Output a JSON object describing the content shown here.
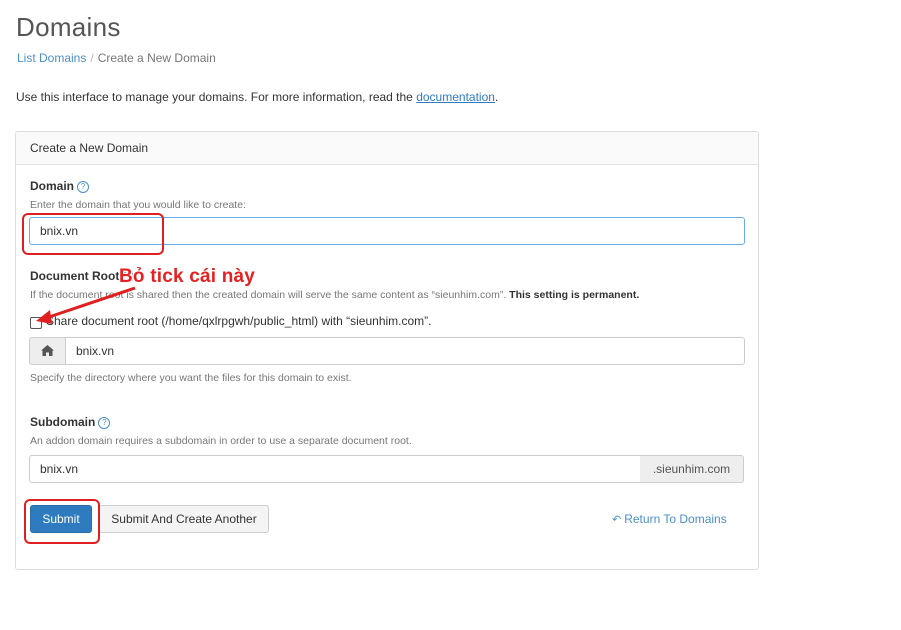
{
  "page": {
    "title": "Domains",
    "breadcrumb": {
      "link": "List Domains",
      "separator": "/",
      "current": "Create a New Domain"
    },
    "intro_text": "Use this interface to manage your domains. For more information, read the ",
    "intro_link": "documentation",
    "intro_end": "."
  },
  "panel": {
    "heading": "Create a New Domain",
    "domain": {
      "label": "Domain",
      "help": "?",
      "hint": "Enter the domain that you would like to create:",
      "value": "bnix.vn"
    },
    "docroot": {
      "label": "Document Root",
      "help": "?",
      "hint_normal": "If the document root is shared then the created domain will serve the same content as “sieunhim.com”. ",
      "hint_bold": "This setting is permanent.",
      "share_label": "Share document root (/home/qxlrpgwh/public_html) with “sieunhim.com”.",
      "share_checked": false,
      "home_icon": "home-icon",
      "value": "bnix.vn",
      "help_text": "Specify the directory where you want the files for this domain to exist."
    },
    "subdomain": {
      "label": "Subdomain",
      "help": "?",
      "hint": "An addon domain requires a subdomain in order to use a separate document root.",
      "value": "bnix.vn",
      "suffix": ".sieunhim.com"
    },
    "buttons": {
      "submit": "Submit",
      "submit_another": "Submit And Create Another",
      "return": "Return To Domains"
    }
  },
  "annotation": {
    "text": "Bỏ tick cái này",
    "color": "#e52222"
  },
  "colors": {
    "accent": "#2f7bbf",
    "link": "#4a90c8",
    "annotation": "#e02020"
  }
}
